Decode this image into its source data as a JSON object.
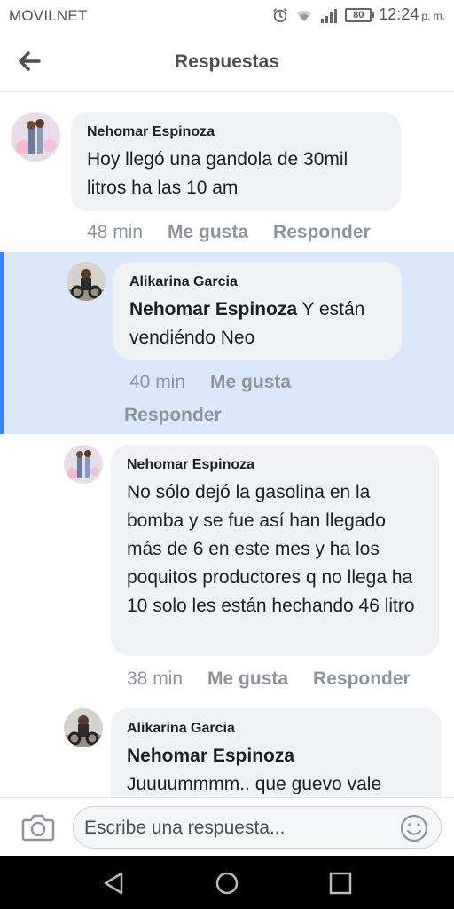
{
  "status_bar": {
    "carrier": "MOVILNET",
    "battery": "80",
    "time": "12:24",
    "ampm": "p. m."
  },
  "header": {
    "title": "Respuestas"
  },
  "comments": [
    {
      "author": "Nehomar Espinoza",
      "mention": "",
      "text": "Hoy llegó una gandola de 30mil litros ha las 10 am",
      "time": "48 min",
      "like": "Me gusta",
      "reply": "Responder"
    },
    {
      "author": "Alikarina Garcia",
      "mention": "Nehomar Espinoza",
      "text": " Y están vendiéndo Neo",
      "time": "40 min",
      "like": "Me gusta",
      "reply": "Responder"
    },
    {
      "author": "Nehomar Espinoza",
      "mention": "",
      "text": "No sólo dejó la gasolina en la bomba y se fue así han llegado más de 6 en este mes y ha los poquitos productores q no llega ha 10 solo les están hechando 46 litro",
      "time": "38 min",
      "like": "Me gusta",
      "reply": "Responder"
    },
    {
      "author": "Alikarina Garcia",
      "mention": "Nehomar Espinoza",
      "text": "Juuuummmm.. que guevo vale",
      "time": "",
      "like": "",
      "reply": ""
    }
  ],
  "composer": {
    "placeholder": "Escribe una respuesta..."
  },
  "colors": {
    "highlight": "#dbe7fb",
    "accent": "#3b82f6",
    "bubble": "#f0f2f5"
  }
}
